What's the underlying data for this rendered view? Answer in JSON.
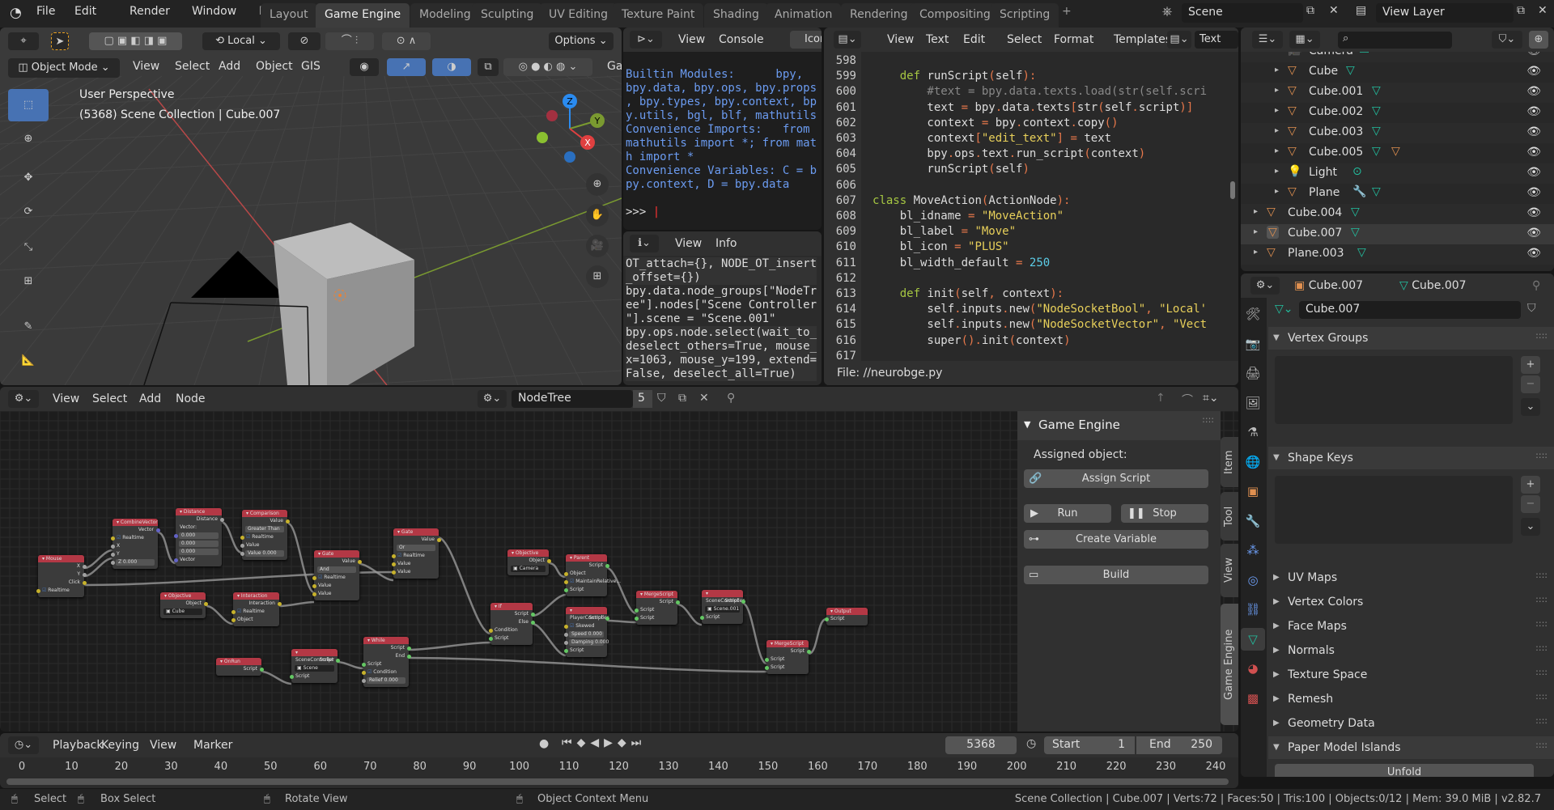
{
  "topbar": {
    "menus": [
      "File",
      "Edit",
      "Render",
      "Window",
      "Help"
    ],
    "workspaces": [
      "Layout",
      "Game Engine",
      "Modeling",
      "Sculpting",
      "UV Editing",
      "Texture Paint",
      "Shading",
      "Animation",
      "Rendering",
      "Compositing",
      "Scripting"
    ],
    "active_workspace": "Game Engine",
    "add_tab": "+",
    "scene": "Scene",
    "view_layer": "View Layer"
  },
  "viewport": {
    "transform_orientation": "Local",
    "options": "Options",
    "mode": "Object Mode",
    "menus": [
      "View",
      "Select",
      "Add",
      "Object",
      "GIS"
    ],
    "extra": "Ga",
    "overlay_title": "User Perspective",
    "overlay_sub": "(5368) Scene Collection | Cube.007",
    "gizmo": {
      "x": "X",
      "y": "Y",
      "z": "Z"
    }
  },
  "console": {
    "menus": [
      "View",
      "Console"
    ],
    "tab": "Icon",
    "lines": [
      "Builtin Modules:      bpy,",
      "bpy.data, bpy.ops, bpy.props",
      ", bpy.types, bpy.context, bp",
      "y.utils, bgl, blf, mathutils",
      "Convenience Imports:   from",
      "mathutils import *; from mat",
      "h import *",
      "Convenience Variables: C = b",
      "py.context, D = bpy.data"
    ],
    "prompt": ">>> "
  },
  "info": {
    "menus": [
      "View",
      "Info"
    ],
    "lines": [
      "OT_attach={}, NODE_OT_insert",
      "_offset={})",
      "bpy.data.node_groups[\"NodeTr",
      "ee\"].nodes[\"Scene Controller",
      "\"].scene = \"Scene.001\"",
      "bpy.ops.node.select(wait_to_",
      "deselect_others=True, mouse_",
      "x=1063, mouse_y=199, extend=",
      "False, deselect_all=True)"
    ]
  },
  "text_editor": {
    "menus": [
      "View",
      "Text",
      "Edit",
      "Select",
      "Format",
      "Templates"
    ],
    "text_label": "Text",
    "file": "File: //neurobge.py",
    "first_line": 598,
    "lines": [
      "",
      "    def runScript(self):",
      "        #text = bpy.data.texts.load(str(self.scri",
      "        text = bpy.data.texts[str(self.script)]",
      "        context = bpy.context.copy()",
      "        context[\"edit_text\"] = text",
      "        bpy.ops.text.run_script(context)",
      "        runScript(self)",
      "",
      "class MoveAction(ActionNode):",
      "    bl_idname = \"MoveAction\"",
      "    bl_label = \"Move\"",
      "    bl_icon = \"PLUS\"",
      "    bl_width_default = 250",
      "",
      "    def init(self, context):",
      "        self.inputs.new(\"NodeSocketBool\", \"Local'",
      "        self.inputs.new(\"NodeSocketVector\", \"Vect",
      "        super().init(context)",
      ""
    ]
  },
  "outliner": {
    "search_placeholder": "",
    "items": [
      {
        "name": "Camera",
        "icon": "camera",
        "depth": 2,
        "extra": [
          "camera-data"
        ]
      },
      {
        "name": "Cube",
        "icon": "mesh",
        "depth": 2,
        "extra": [
          "mesh-data"
        ]
      },
      {
        "name": "Cube.001",
        "icon": "mesh",
        "depth": 2,
        "extra": [
          "mesh-data"
        ]
      },
      {
        "name": "Cube.002",
        "icon": "mesh",
        "depth": 2,
        "extra": [
          "mesh-data"
        ]
      },
      {
        "name": "Cube.003",
        "icon": "mesh",
        "depth": 2,
        "extra": [
          "mesh-data"
        ]
      },
      {
        "name": "Cube.005",
        "icon": "mesh",
        "depth": 2,
        "extra": [
          "mesh-data",
          "mesh"
        ]
      },
      {
        "name": "Light",
        "icon": "light",
        "depth": 2,
        "extra": [
          "light-data"
        ]
      },
      {
        "name": "Plane",
        "icon": "mesh",
        "depth": 2,
        "extra": [
          "modifier",
          "mesh-data"
        ]
      },
      {
        "name": "Cube.004",
        "icon": "mesh",
        "depth": 1,
        "extra": [
          "mesh-data"
        ]
      },
      {
        "name": "Cube.007",
        "icon": "mesh",
        "depth": 1,
        "extra": [
          "mesh-data"
        ],
        "active": true
      },
      {
        "name": "Plane.003",
        "icon": "mesh",
        "depth": 1,
        "extra": [
          "mesh-data"
        ]
      }
    ]
  },
  "properties": {
    "object": "Cube.007",
    "mesh": "Cube.007",
    "datablock": "Cube.007",
    "sections": [
      {
        "label": "Vertex Groups",
        "open": true
      },
      {
        "label": "Shape Keys",
        "open": true
      },
      {
        "label": "UV Maps"
      },
      {
        "label": "Vertex Colors"
      },
      {
        "label": "Face Maps"
      },
      {
        "label": "Normals"
      },
      {
        "label": "Texture Space"
      },
      {
        "label": "Remesh"
      },
      {
        "label": "Geometry Data"
      },
      {
        "label": "Paper Model Islands",
        "open": true
      }
    ],
    "unfold": "Unfold"
  },
  "node_editor": {
    "menus": [
      "View",
      "Select",
      "Add",
      "Node"
    ],
    "tree_name": "NodeTree",
    "users": "5",
    "sidebar_tabs": [
      "Item",
      "Tool",
      "View",
      "Game Engine"
    ],
    "active_sidebar_tab": "Game Engine",
    "panel": {
      "title": "Game Engine",
      "assigned": "Assigned object:",
      "assign_script": "Assign Script",
      "run": "Run",
      "stop": "Stop",
      "create_variable": "Create Variable",
      "build": "Build"
    },
    "nodes": [
      {
        "title": "Mouse",
        "rows": [
          [
            "out",
            "X",
            "g"
          ],
          [
            "out",
            "Y",
            "g"
          ],
          [
            "out",
            "Click",
            "y"
          ],
          [
            "check",
            "Realtime",
            "y"
          ]
        ]
      },
      {
        "title": "CombineVector",
        "rows": [
          [
            "out",
            "Vector",
            "b"
          ],
          [
            "check",
            "Realtime",
            "y"
          ],
          [
            "in",
            "X",
            "g"
          ],
          [
            "in",
            "Y",
            "g"
          ],
          [
            "field",
            "Z   0.000",
            "g"
          ]
        ]
      },
      {
        "title": "Distance",
        "rows": [
          [
            "out",
            "Distance",
            "g"
          ],
          [
            "label",
            "Vector:",
            ""
          ],
          [
            "field",
            "0.000",
            "b"
          ],
          [
            "field",
            "0.000",
            ""
          ],
          [
            "field",
            "0.000",
            ""
          ],
          [
            "in",
            "Vector",
            "b"
          ]
        ]
      },
      {
        "title": "Comparison",
        "rows": [
          [
            "out",
            "Value",
            "y"
          ],
          [
            "dropdown",
            "Greater Than",
            ""
          ],
          [
            "check",
            "Realtime",
            "y"
          ],
          [
            "in",
            "Value",
            "g"
          ],
          [
            "field",
            "Value   0.000",
            "g"
          ]
        ]
      },
      {
        "title": "Gate",
        "rows": [
          [
            "out",
            "Value",
            "y"
          ],
          [
            "dropdown",
            "And",
            ""
          ],
          [
            "check",
            "Realtime",
            "y"
          ],
          [
            "in",
            "Value",
            "y"
          ],
          [
            "in",
            "Value",
            "y"
          ]
        ]
      },
      {
        "title": "Gate",
        "rows": [
          [
            "out",
            "Value",
            "y"
          ],
          [
            "dropdown",
            "Or",
            ""
          ],
          [
            "check",
            "Realtime",
            "y"
          ],
          [
            "in",
            "Value",
            "y"
          ],
          [
            "in",
            "Value",
            "y"
          ]
        ]
      },
      {
        "title": "Objective",
        "rows": [
          [
            "out",
            "Object",
            "y"
          ],
          [
            "object",
            "Cube",
            ""
          ]
        ]
      },
      {
        "title": "Interaction",
        "rows": [
          [
            "out",
            "Interaction",
            "y"
          ],
          [
            "check",
            "Realtime",
            "y"
          ],
          [
            "in",
            "Object",
            "y"
          ]
        ]
      },
      {
        "title": "OnRun",
        "rows": [
          [
            "out",
            "Script",
            "s"
          ]
        ]
      },
      {
        "title": "SceneController",
        "rows": [
          [
            "out",
            "Script",
            "s"
          ],
          [
            "object",
            "Scene",
            ""
          ],
          [
            "in",
            "Script",
            "s"
          ]
        ]
      },
      {
        "title": "While",
        "rows": [
          [
            "out",
            "Script",
            "s"
          ],
          [
            "out",
            "End",
            "s"
          ],
          [
            "in",
            "Script",
            "s"
          ],
          [
            "check",
            "Condition",
            "y"
          ],
          [
            "field",
            "Relief   0.000",
            "g"
          ]
        ]
      },
      {
        "title": "If",
        "rows": [
          [
            "out",
            "Script",
            "s"
          ],
          [
            "out",
            "Else",
            "s"
          ],
          [
            "in",
            "Condition",
            "y"
          ],
          [
            "in",
            "Script",
            "s"
          ]
        ]
      },
      {
        "title": "Objective",
        "rows": [
          [
            "out",
            "Object",
            "y"
          ],
          [
            "object",
            "Camera",
            ""
          ]
        ]
      },
      {
        "title": "Parent",
        "rows": [
          [
            "out",
            "Script",
            "s"
          ],
          [
            "in",
            "Object",
            "y"
          ],
          [
            "check",
            "MaintainRelative...",
            "y"
          ],
          [
            "in",
            "Script",
            "s"
          ]
        ]
      },
      {
        "title": "PlayerController",
        "rows": [
          [
            "out",
            "Script",
            "s"
          ],
          [
            "check",
            "Skewed",
            "y"
          ],
          [
            "field",
            "Speed   0.000",
            "g"
          ],
          [
            "field",
            "Damping  0.000",
            "g"
          ],
          [
            "in",
            "Script",
            "s"
          ]
        ]
      },
      {
        "title": "MergeScript",
        "rows": [
          [
            "out",
            "Script",
            "s"
          ],
          [
            "in",
            "Script",
            "s"
          ],
          [
            "in",
            "Script",
            "s"
          ]
        ]
      },
      {
        "title": "SceneController",
        "rows": [
          [
            "out",
            "Script",
            "s"
          ],
          [
            "object",
            "Scene.001",
            ""
          ],
          [
            "in",
            "Script",
            "s"
          ]
        ]
      },
      {
        "title": "MergeScript",
        "rows": [
          [
            "out",
            "Script",
            "s"
          ],
          [
            "in",
            "Script",
            "s"
          ],
          [
            "in",
            "Script",
            "s"
          ]
        ]
      },
      {
        "title": "Output",
        "rows": [
          [
            "in",
            "Script",
            "s"
          ]
        ]
      }
    ]
  },
  "timeline": {
    "menus": [
      "Playback",
      "Keying",
      "View",
      "Marker"
    ],
    "frame": "5368",
    "start_label": "Start",
    "start": "1",
    "end_label": "End",
    "end": "250",
    "ticks": [
      "0",
      "10",
      "20",
      "30",
      "40",
      "50",
      "60",
      "70",
      "80",
      "90",
      "100",
      "110",
      "120",
      "130",
      "140",
      "150",
      "160",
      "170",
      "180",
      "190",
      "200",
      "210",
      "220",
      "230",
      "240"
    ]
  },
  "statusbar": {
    "items": [
      "Select",
      "Box Select",
      "Rotate View",
      "Object Context Menu"
    ],
    "stats": "Scene Collection | Cube.007 | Verts:72 | Faces:50 | Tris:100 | Objects:0/12 | Mem: 39.0 MiB | v2.82.7"
  },
  "colors": {
    "accent": "#4772b3",
    "node_header": "#b33845",
    "socket_value": "#c7b22b",
    "socket_script": "#63c763",
    "socket_vector": "#6363c7",
    "mesh_icon": "#e09050",
    "data_icon": "#22c0a0"
  }
}
